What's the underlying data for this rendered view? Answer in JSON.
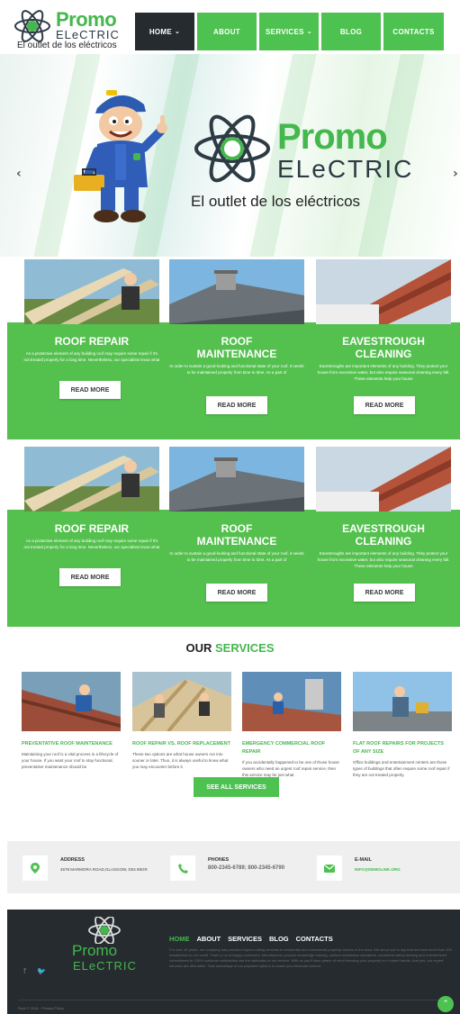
{
  "header": {
    "logo_name": "Promo",
    "logo_sub": "ELeCTRIC",
    "logo_tagline": "El outlet de los eléctricos",
    "nav": [
      {
        "label": "HOME",
        "active": true,
        "caret": "⌄"
      },
      {
        "label": "ABOUT",
        "active": false,
        "caret": ""
      },
      {
        "label": "SERVICES",
        "active": false,
        "caret": "⌄"
      },
      {
        "label": "BLOG",
        "active": false,
        "caret": ""
      },
      {
        "label": "CONTACTS",
        "active": false,
        "caret": ""
      }
    ]
  },
  "hero": {
    "brand_name": "Promo",
    "brand_sub": "ELeCTRIC",
    "brand_tagline": "El outlet de los eléctricos",
    "prev_icon": "chevron-left-icon",
    "next_icon": "chevron-right-icon"
  },
  "features": {
    "rows": [
      {
        "items": [
          {
            "title": "ROOF REPAIR",
            "text": "As a protective element of any building roof may require some repair if it's not treated properly for a long time. Nevertheless, our specialists know what",
            "button": "READ MORE"
          },
          {
            "title": "ROOF MAINTENANCE",
            "text": "In order to sustain a good-looking and functional state of your roof, it needs to be maintained properly from time to time. As a part of",
            "button": "READ MORE"
          },
          {
            "title": "EAVESTROUGH CLEANING",
            "text": "Eavestroughs are important elements of any building. They protect your house from excessive water, but also require seasonal cleaning every fall. These elements help your house",
            "button": "READ MORE"
          }
        ]
      },
      {
        "items": [
          {
            "title": "ROOF REPAIR",
            "text": "As a protective element of any building roof may require some repair if it's not treated properly for a long time. Nevertheless, our specialists know what",
            "button": "READ MORE"
          },
          {
            "title": "ROOF MAINTENANCE",
            "text": "In order to sustain a good-looking and functional state of your roof, it needs to be maintained properly from time to time. As a part of",
            "button": "READ MORE"
          },
          {
            "title": "EAVESTROUGH CLEANING",
            "text": "Eavestroughs are important elements of any building. They protect your house from excessive water, but also require seasonal cleaning every fall. These elements help your house",
            "button": "READ MORE"
          }
        ]
      }
    ]
  },
  "services": {
    "heading_main": "OUR ",
    "heading_accent": "SERVICES",
    "cards": [
      {
        "title": "PREVENTATIVE ROOF MAINTENANCE",
        "desc": "Maintaining your roof is a vital process in a lifecycle of your house. If you want your roof to stay functional, preventative maintenance should be"
      },
      {
        "title": "ROOF REPAIR VS. ROOF REPLACEMENT",
        "desc": "These two options are what house owners run into sooner or later. Thus, it is always useful to know what you may encounter before it"
      },
      {
        "title": "EMERGENCY COMMERCIAL ROOF REPAIR",
        "desc": "If you accidentally happened to be one of those house owners who need an urgent roof repair service, then this service may be just what"
      },
      {
        "title": "FLAT ROOF REPAIRS FOR PROJECTS OF ANY SIZE",
        "desc": "Office buildings and entertainment centers are those types of buildings that often require some roof repair if they are not treated properly."
      }
    ],
    "see_all": "SEE ALL SERVICES"
  },
  "contact": {
    "address_label": "ADDRESS",
    "address_value": "4578 MARMORA ROAD,GLASGOW, D04 89GR",
    "phones_label": "PHONES",
    "phones_value": "800-2345-6789;  800-2345-6790",
    "email_label": "E-MAIL",
    "email_value": "INFO@DEMOLINK.ORG",
    "accent": "#44b74d"
  },
  "footer": {
    "logo_name": "Promo",
    "logo_sub": "ELeCTRIC",
    "nav": [
      {
        "label": "HOME",
        "active": true
      },
      {
        "label": "ABOUT",
        "active": false
      },
      {
        "label": "SERVICES",
        "active": false
      },
      {
        "label": "BLOG",
        "active": false
      },
      {
        "label": "CONTACTS",
        "active": false
      }
    ],
    "about_text": "For over 40 years, our company has provided expert roofing services to residential and commercial property owners in the area. We are proud to say that we have more than 100 installations to our credit. That's a lot of happy customers. Manufacturer product knowledge training, uniform installation standards, consistent safety training and a determined commitment to 100% customer satisfaction are the hallmarks of our service. With us you'll have peace of mind knowing your property is in expert hands. And yes, our expert services are affordable. Take advantage of our payment options to match your financial comfort.",
    "social": [
      "f",
      "🐦"
    ],
    "copyright": "Roof © 2016 · Privacy Policy"
  },
  "colors": {
    "brand_green": "#44b74d",
    "nav_green": "#4ec250",
    "nav_active": "#262b30",
    "footer_bg": "#262b30"
  }
}
